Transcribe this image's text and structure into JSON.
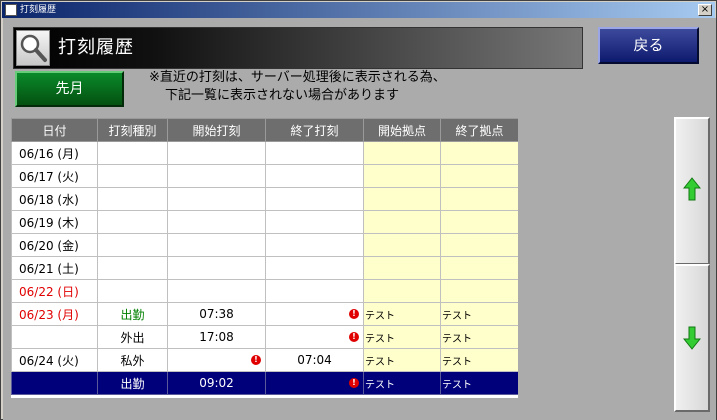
{
  "window": {
    "title": "打刻履歴",
    "close_symbol": "×"
  },
  "header": {
    "title": "打刻履歴",
    "icon": "search-icon"
  },
  "buttons": {
    "back": "戻る",
    "prev_month": "先月"
  },
  "notice": {
    "line1": "※直近の打刻は、サーバー処理後に表示される為、",
    "line2": "下記一覧に表示されない場合があります"
  },
  "table": {
    "columns": [
      "日付",
      "打刻種別",
      "開始打刻",
      "終了打刻",
      "開始拠点",
      "終了拠点"
    ],
    "rows": [
      {
        "date": "06/16 (月)",
        "type": "",
        "start": "",
        "end": "",
        "start_base": "",
        "end_base": ""
      },
      {
        "date": "06/17 (火)",
        "type": "",
        "start": "",
        "end": "",
        "start_base": "",
        "end_base": ""
      },
      {
        "date": "06/18 (水)",
        "type": "",
        "start": "",
        "end": "",
        "start_base": "",
        "end_base": ""
      },
      {
        "date": "06/19 (木)",
        "type": "",
        "start": "",
        "end": "",
        "start_base": "",
        "end_base": ""
      },
      {
        "date": "06/20 (金)",
        "type": "",
        "start": "",
        "end": "",
        "start_base": "",
        "end_base": ""
      },
      {
        "date": "06/21 (土)",
        "type": "",
        "start": "",
        "end": "",
        "start_base": "",
        "end_base": ""
      },
      {
        "date": "06/22 (日)",
        "type": "",
        "start": "",
        "end": "",
        "start_base": "",
        "end_base": ""
      },
      {
        "date": "06/23 (月)",
        "type": "出勤",
        "start": "07:38",
        "end": "",
        "start_base": "テスト",
        "end_base": "テスト"
      },
      {
        "date": "",
        "type": "外出",
        "start": "17:08",
        "end": "",
        "start_base": "テスト",
        "end_base": "テスト"
      },
      {
        "date": "06/24 (火)",
        "type": "私外",
        "start": "",
        "end": "07:04",
        "start_base": "テスト",
        "end_base": "テスト"
      },
      {
        "date": "",
        "type": "出勤",
        "start": "09:02",
        "end": "",
        "start_base": "テスト",
        "end_base": "テスト"
      }
    ],
    "alert_symbol": "!"
  },
  "colors": {
    "title_bar": "#0a246a",
    "back_button": "#0d1a6e",
    "prev_month_button": "#045010",
    "holiday_text": "#e00000",
    "work_type_text": "#008000",
    "base_cell_bg": "#ffffcc",
    "selected_row": "#00007b",
    "scroll_arrow": "#33cc33"
  }
}
